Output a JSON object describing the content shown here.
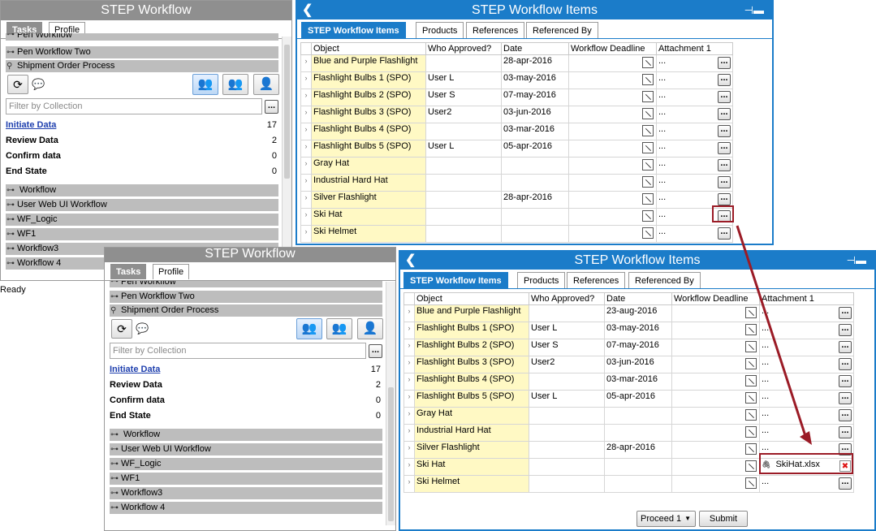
{
  "left_panel": {
    "title": "STEP Workflow",
    "tabs": [
      "Tasks",
      "Profile"
    ],
    "workflows_top": [
      "Pen Workflow",
      "Pen Workflow Two",
      "Shipment Order Process"
    ],
    "filter_placeholder": "Filter by Collection",
    "states": [
      {
        "name": "Initiate Data",
        "count": "17"
      },
      {
        "name": "Review Data",
        "count": "2"
      },
      {
        "name": "Confirm data",
        "count": "0"
      },
      {
        "name": "End State",
        "count": "0"
      }
    ],
    "workflows_bottom": [
      "Workflow",
      "User Web UI Workflow",
      "WF_Logic",
      "WF1",
      "Workflow3",
      "Workflow 4"
    ],
    "dots": "..."
  },
  "status_bar": {
    "text": "Ready"
  },
  "right_panel": {
    "title": "STEP Workflow Items",
    "tabs": [
      "STEP Workflow Items",
      "Products",
      "References",
      "Referenced By"
    ],
    "columns": [
      "Object",
      "Who Approved?",
      "Date",
      "Workflow Deadline",
      "Attachment 1"
    ],
    "ellipsis": "...",
    "rows_top": [
      {
        "object": "Blue and Purple Flashlight",
        "who": "",
        "date": "28-apr-2016"
      },
      {
        "object": "Flashlight Bulbs 1 (SPO)",
        "who": "User L",
        "date": "03-may-2016"
      },
      {
        "object": "Flashlight Bulbs 2 (SPO)",
        "who": "User S",
        "date": "07-may-2016"
      },
      {
        "object": "Flashlight Bulbs 3 (SPO)",
        "who": "User2",
        "date": "03-jun-2016"
      },
      {
        "object": "Flashlight Bulbs 4 (SPO)",
        "who": "",
        "date": "03-mar-2016"
      },
      {
        "object": "Flashlight Bulbs 5 (SPO)",
        "who": "User L",
        "date": "05-apr-2016"
      },
      {
        "object": "Gray Hat",
        "who": "",
        "date": ""
      },
      {
        "object": "Industrial Hard Hat",
        "who": "",
        "date": ""
      },
      {
        "object": "Silver Flashlight",
        "who": "",
        "date": "28-apr-2016"
      },
      {
        "object": "Ski Hat",
        "who": "",
        "date": ""
      },
      {
        "object": "Ski Helmet",
        "who": "",
        "date": ""
      }
    ],
    "rows_bottom": [
      {
        "object": "Blue and Purple Flashlight",
        "who": "",
        "date": "23-aug-2016"
      },
      {
        "object": "Flashlight Bulbs 1 (SPO)",
        "who": "User L",
        "date": "03-may-2016"
      },
      {
        "object": "Flashlight Bulbs 2 (SPO)",
        "who": "User S",
        "date": "07-may-2016"
      },
      {
        "object": "Flashlight Bulbs 3 (SPO)",
        "who": "User2",
        "date": "03-jun-2016"
      },
      {
        "object": "Flashlight Bulbs 4 (SPO)",
        "who": "",
        "date": "03-mar-2016"
      },
      {
        "object": "Flashlight Bulbs 5 (SPO)",
        "who": "User L",
        "date": "05-apr-2016"
      },
      {
        "object": "Gray Hat",
        "who": "",
        "date": ""
      },
      {
        "object": "Industrial Hard Hat",
        "who": "",
        "date": ""
      },
      {
        "object": "Silver Flashlight",
        "who": "",
        "date": "28-apr-2016"
      },
      {
        "object": "Ski Hat",
        "who": "",
        "date": ""
      },
      {
        "object": "Ski Helmet",
        "who": "",
        "date": ""
      }
    ],
    "attachment_file": "SkiHat.xlsx",
    "proceed_label": "Proceed 1",
    "submit_label": "Submit"
  },
  "colors": {
    "accent": "#1b7cc9",
    "highlight": "#9b1b26",
    "object_cell": "#fff9c4",
    "gray_row": "#bdbdbd"
  },
  "icons": [
    "refresh-icon",
    "comment-icon",
    "group-icon",
    "person-icon",
    "back-icon",
    "pin-icon",
    "calendar-icon",
    "paperclip-icon",
    "delete-icon",
    "workflow-key-icon"
  ]
}
